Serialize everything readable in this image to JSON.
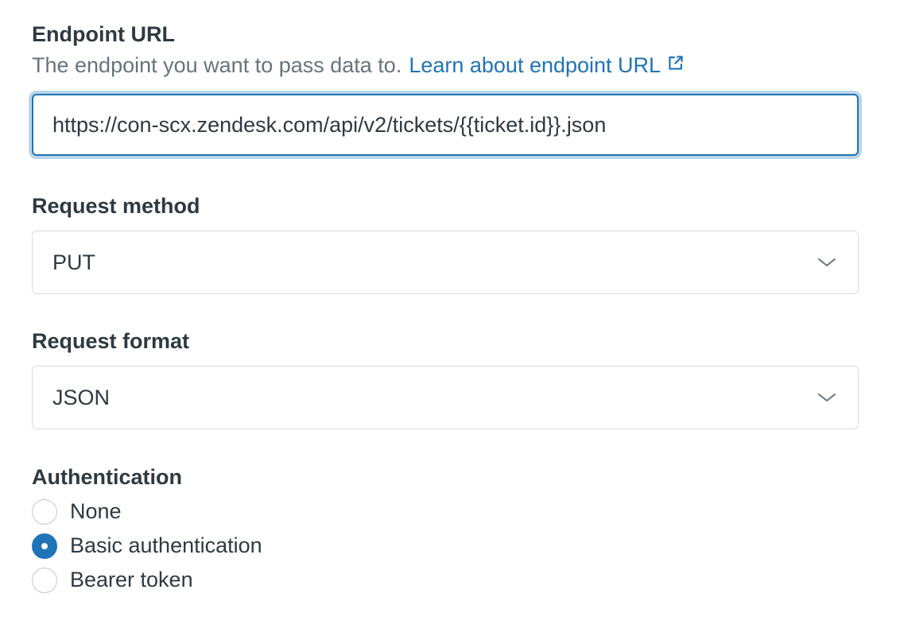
{
  "endpoint": {
    "label": "Endpoint URL",
    "hint": "The endpoint you want to pass data to.",
    "link_text": "Learn about endpoint URL",
    "link_icon": "external-link-icon",
    "value": "https://con-scx.zendesk.com/api/v2/tickets/{{ticket.id}}.json"
  },
  "request_method": {
    "label": "Request method",
    "selected": "PUT",
    "icon": "chevron-down-icon"
  },
  "request_format": {
    "label": "Request format",
    "selected": "JSON",
    "icon": "chevron-down-icon"
  },
  "authentication": {
    "label": "Authentication",
    "options": [
      {
        "label": "None",
        "checked": false
      },
      {
        "label": "Basic authentication",
        "checked": true
      },
      {
        "label": "Bearer token",
        "checked": false
      }
    ]
  },
  "colors": {
    "accent": "#1f73b7",
    "text": "#2f3941",
    "muted": "#68737d",
    "border": "#d8dcde"
  }
}
